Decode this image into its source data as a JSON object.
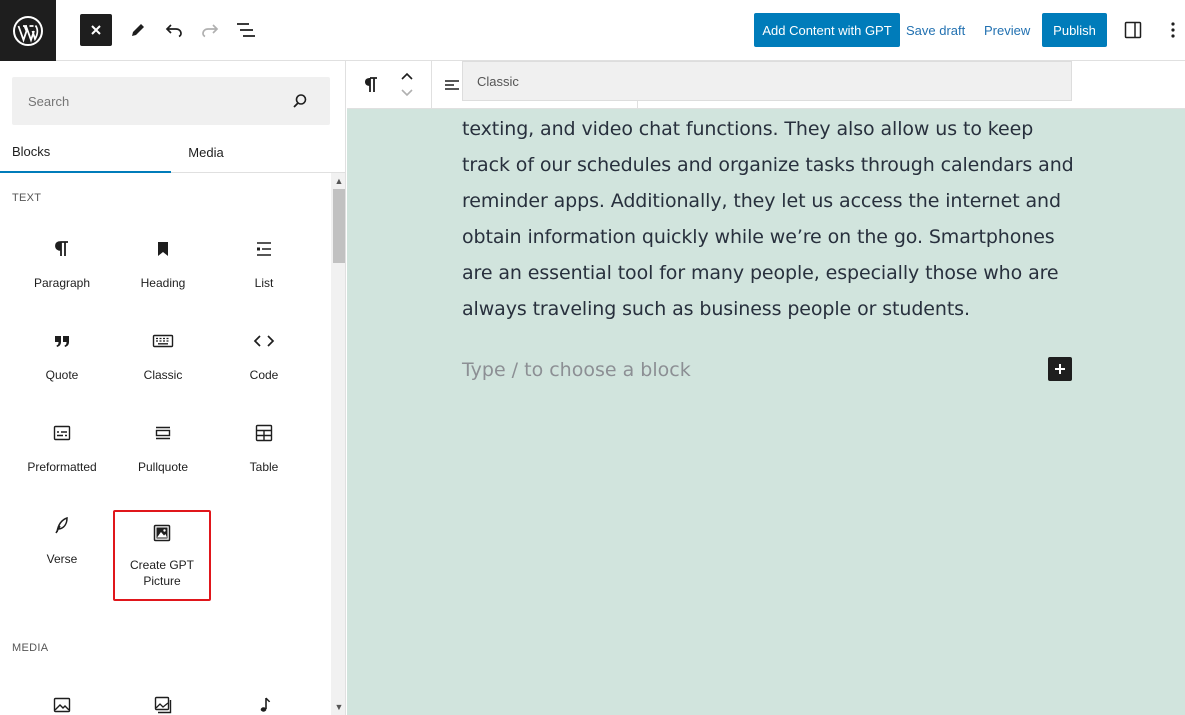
{
  "topbar": {
    "gpt_button": "Add Content with GPT",
    "save_draft": "Save draft",
    "preview": "Preview",
    "publish": "Publish"
  },
  "sidebar": {
    "search_placeholder": "Search",
    "tabs": [
      {
        "label": "Blocks"
      },
      {
        "label": "Media"
      }
    ],
    "categories": {
      "text": "TEXT",
      "media": "MEDIA"
    },
    "text_blocks": [
      {
        "label": "Paragraph",
        "icon": "paragraph-icon"
      },
      {
        "label": "Heading",
        "icon": "bookmark-icon"
      },
      {
        "label": "List",
        "icon": "list-icon"
      },
      {
        "label": "Quote",
        "icon": "quote-icon"
      },
      {
        "label": "Classic",
        "icon": "keyboard-icon"
      },
      {
        "label": "Code",
        "icon": "code-icon"
      },
      {
        "label": "Preformatted",
        "icon": "preformatted-icon"
      },
      {
        "label": "Pullquote",
        "icon": "pullquote-icon"
      },
      {
        "label": "Table",
        "icon": "table-icon"
      },
      {
        "label": "Verse",
        "icon": "feather-icon"
      },
      {
        "label": "Create GPT Picture",
        "icon": "image-icon"
      }
    ]
  },
  "editor": {
    "toolbar_tooltip": "Classic",
    "paragraph": "texting, and video chat functions. They also allow us to keep track of our schedules and organize tasks through calendars and reminder apps. Additionally, they let us access the internet and obtain information quickly while we’re on the go. Smartphones are an essential tool for many people, especially those who are always traveling such as business people or students.",
    "placeholder": "Type / to choose a block"
  },
  "colors": {
    "accent": "#007cba",
    "editor_bg": "#d1e4dd",
    "highlight": "#e0161b"
  }
}
